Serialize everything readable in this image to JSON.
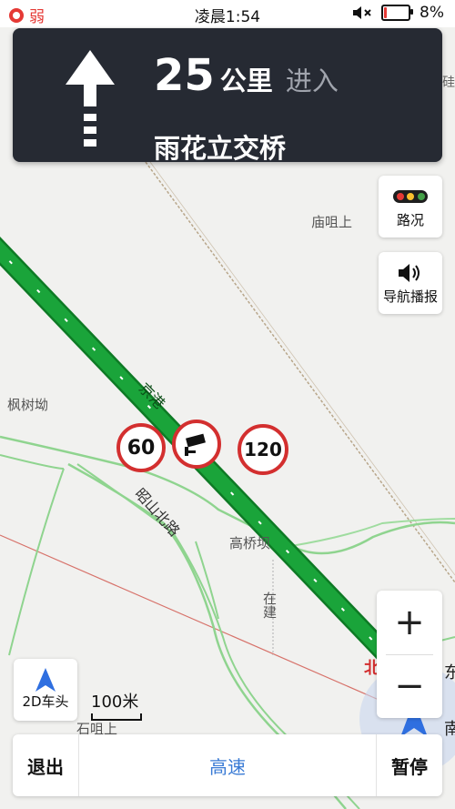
{
  "status_bar": {
    "signal_text": "弱",
    "time": "凌晨1:54",
    "battery": "8%"
  },
  "nav_card": {
    "distance": "25",
    "unit": "公里",
    "action": "进入",
    "road": "雨花立交桥"
  },
  "buttons": {
    "traffic": "路况",
    "voice": "导航播报",
    "heading": "2D车头",
    "exit": "退出",
    "mode": "高速",
    "pause": "暂停",
    "zoom_in": "+",
    "zoom_out": "−"
  },
  "scale": "100米",
  "speed_signs": {
    "left": "60",
    "right": "120"
  },
  "map_labels": {
    "miaozuishang": "庙咀上",
    "fengshuwa": "枫树坳",
    "zhaoshan_north_road": "昭山北路",
    "gaoqiaoba": "高桥坝",
    "zaijian": "在建",
    "shizuishang": "石咀上",
    "jinggang": "京港",
    "bei": "北",
    "dong": "东",
    "nan": "南",
    "jie": "硅"
  },
  "colors": {
    "route": "#1aa43a",
    "card_bg": "#262a33",
    "accent_blue": "#3a7bd5",
    "sign_red": "#d32f2f"
  }
}
